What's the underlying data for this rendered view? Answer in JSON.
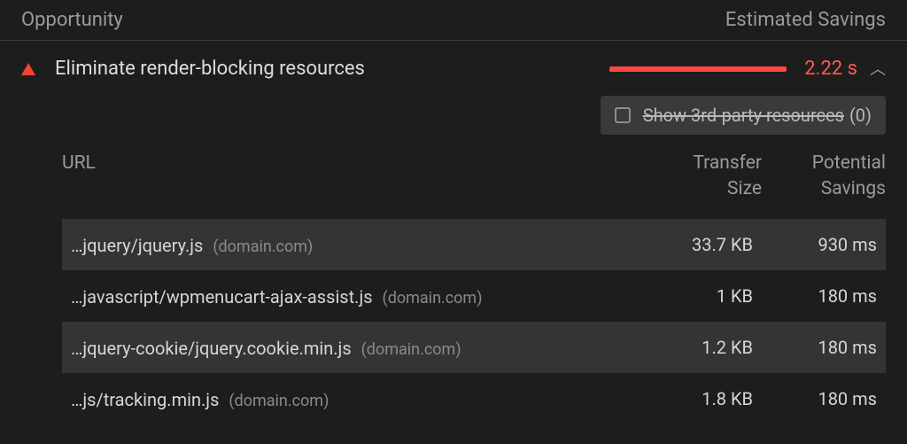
{
  "header": {
    "left": "Opportunity",
    "right": "Estimated Savings"
  },
  "opportunity": {
    "title": "Eliminate render-blocking resources",
    "savings": "2.22 s"
  },
  "filter": {
    "label": "Show 3rd-party resources",
    "count": "(0)"
  },
  "table": {
    "headers": {
      "url": "URL",
      "size_line1": "Transfer",
      "size_line2": "Size",
      "save_line1": "Potential",
      "save_line2": "Savings"
    },
    "rows": [
      {
        "path": "…jquery/jquery.js",
        "domain": "(domain.com)",
        "size": "33.7 KB",
        "savings": "930 ms"
      },
      {
        "path": "…javascript/wpmenucart-ajax-assist.js",
        "domain": "(domain.com)",
        "size": "1 KB",
        "savings": "180 ms"
      },
      {
        "path": "…jquery-cookie/jquery.cookie.min.js",
        "domain": "(domain.com)",
        "size": "1.2 KB",
        "savings": "180 ms"
      },
      {
        "path": "…js/tracking.min.js",
        "domain": "(domain.com)",
        "size": "1.8 KB",
        "savings": "180 ms"
      }
    ]
  }
}
